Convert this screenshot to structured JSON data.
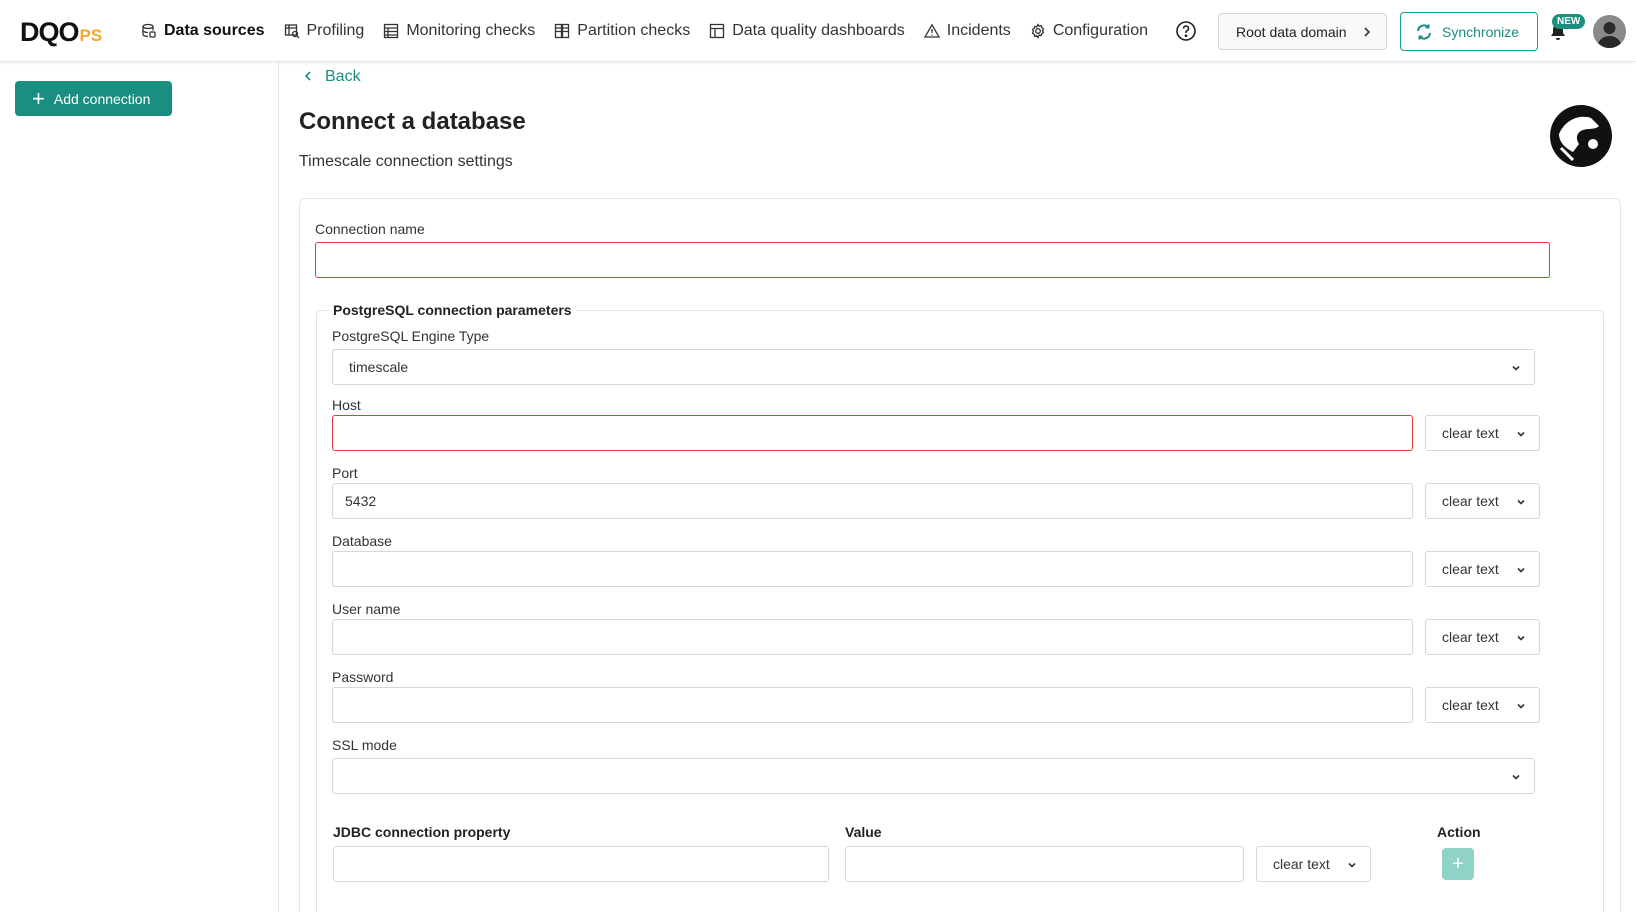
{
  "brand": {
    "logo_main": "DQO",
    "logo_suffix": "PS"
  },
  "nav": {
    "items": [
      {
        "label": "Data sources",
        "icon": "database-icon",
        "active": true
      },
      {
        "label": "Profiling",
        "icon": "profiling-icon"
      },
      {
        "label": "Monitoring checks",
        "icon": "monitoring-checks-icon"
      },
      {
        "label": "Partition checks",
        "icon": "partition-checks-icon"
      },
      {
        "label": "Data quality dashboards",
        "icon": "dashboards-icon"
      },
      {
        "label": "Incidents",
        "icon": "warning-icon"
      },
      {
        "label": "Configuration",
        "icon": "gear-icon"
      }
    ]
  },
  "header": {
    "domain_label": "Root data domain",
    "sync_label": "Synchronize",
    "new_badge": "NEW",
    "accent_color": "#1a8f7f"
  },
  "sidebar": {
    "add_connection_label": "Add connection"
  },
  "page": {
    "back_label": "Back",
    "title": "Connect a database",
    "subtitle": "Timescale connection settings"
  },
  "form": {
    "connection_name_label": "Connection name",
    "connection_name_value": "",
    "params_legend": "PostgreSQL connection parameters",
    "engine_type_label": "PostgreSQL Engine Type",
    "engine_type_value": "timescale",
    "host_label": "Host",
    "host_value": "",
    "host_mode": "clear text",
    "port_label": "Port",
    "port_value": "5432",
    "port_mode": "clear text",
    "database_label": "Database",
    "database_value": "",
    "database_mode": "clear text",
    "user_label": "User name",
    "user_value": "",
    "user_mode": "clear text",
    "password_label": "Password",
    "password_value": "",
    "password_mode": "clear text",
    "ssl_label": "SSL mode",
    "ssl_value": "",
    "jdbc": {
      "col_property": "JDBC connection property",
      "col_value": "Value",
      "col_action": "Action",
      "row_mode": "clear text",
      "add_symbol": "+"
    }
  }
}
